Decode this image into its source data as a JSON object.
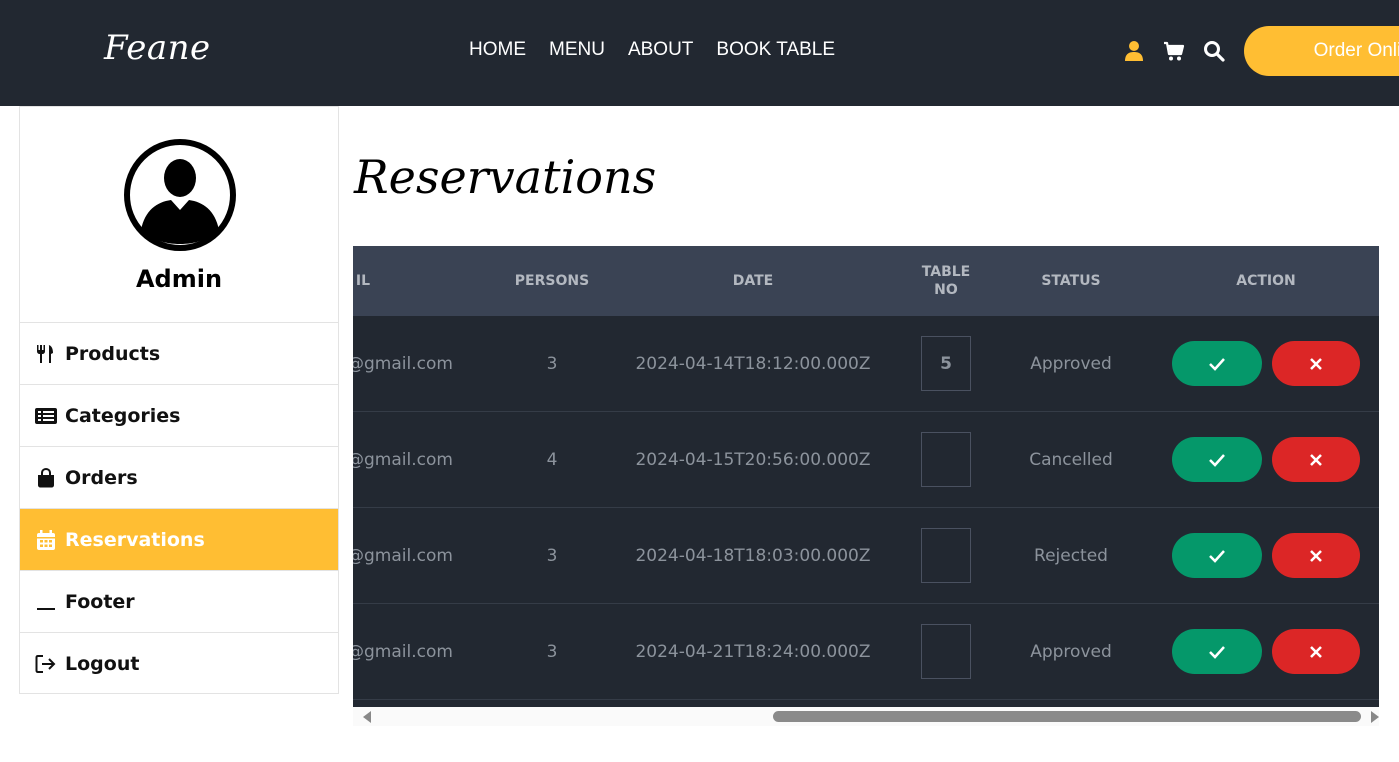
{
  "header": {
    "logo": "Feane",
    "nav": [
      "HOME",
      "MENU",
      "ABOUT",
      "BOOK TABLE"
    ],
    "order_button": "Order Online",
    "icons": [
      "user-icon",
      "cart-icon",
      "search-icon"
    ],
    "accent_color": "#ffbe33",
    "background_color": "#222831"
  },
  "sidebar": {
    "admin_name": "Admin",
    "items": [
      {
        "label": "Products",
        "icon": "utensils-icon",
        "active": false
      },
      {
        "label": "Categories",
        "icon": "list-icon",
        "active": false
      },
      {
        "label": "Orders",
        "icon": "shopping-bag-icon",
        "active": false
      },
      {
        "label": "Reservations",
        "icon": "calendar-icon",
        "active": true
      },
      {
        "label": "Footer",
        "icon": "underscore-icon",
        "active": false
      },
      {
        "label": "Logout",
        "icon": "logout-icon",
        "active": false
      }
    ]
  },
  "main": {
    "title": "Reservations",
    "table": {
      "columns": [
        "IL",
        "PERSONS",
        "DATE",
        "TABLE NO",
        "STATUS",
        "ACTION"
      ],
      "rows": [
        {
          "email": "@gmail.com",
          "persons": "3",
          "date": "2024-04-14T18:12:00.000Z",
          "table_no": "5",
          "status": "Approved"
        },
        {
          "email": "@gmail.com",
          "persons": "4",
          "date": "2024-04-15T20:56:00.000Z",
          "table_no": "",
          "status": "Cancelled"
        },
        {
          "email": "@gmail.com",
          "persons": "3",
          "date": "2024-04-18T18:03:00.000Z",
          "table_no": "",
          "status": "Rejected"
        },
        {
          "email": "@gmail.com",
          "persons": "3",
          "date": "2024-04-21T18:24:00.000Z",
          "table_no": "",
          "status": "Approved"
        }
      ],
      "approve_color": "#05986a",
      "reject_color": "#dc2626"
    }
  }
}
